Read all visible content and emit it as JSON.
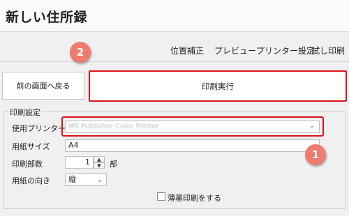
{
  "app": {
    "title": "新しい住所録"
  },
  "menu": {
    "items": [
      "位置補正",
      "プレビュー",
      "プリンター設定",
      "試し印刷"
    ]
  },
  "actions": {
    "back_label": "前の画面へ戻る",
    "print_label": "印刷実行"
  },
  "settings": {
    "legend": "印刷設定",
    "printer_label": "使用プリンター",
    "printer_value": "MS Publisher Color Printer",
    "paper_label": "用紙サイズ",
    "paper_value": "A4",
    "copies_label": "印刷部数",
    "copies_value": "1",
    "copies_unit": "部",
    "orientation_label": "用紙の向き",
    "orientation_value": "縦",
    "draft_label": "薄墨印刷をする",
    "draft_checked": false
  },
  "annotations": {
    "badge_1": "1",
    "badge_2": "2"
  },
  "colors": {
    "highlight": "#d9141b",
    "badge": "#ee7b6f",
    "background": "#f0f0f0"
  }
}
